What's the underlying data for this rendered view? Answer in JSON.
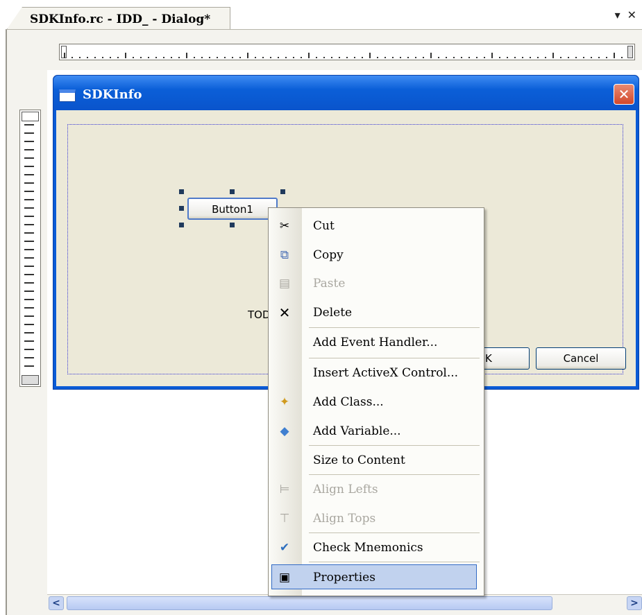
{
  "tab": {
    "title": "SDKInfo.rc - IDD_ - Dialog*",
    "pin_glyph": "▾",
    "close_glyph": "✕"
  },
  "dialog": {
    "title": "SDKInfo",
    "close_glyph": "✕",
    "button1_label": "Button1",
    "ok_label": "OK",
    "cancel_label": "Cancel",
    "static_text": "TODO"
  },
  "scrollbar": {
    "left_arrow": "<",
    "right_arrow": ">"
  },
  "context_menu": {
    "items": [
      {
        "label": "Cut",
        "icon": "scissors-icon",
        "glyph": "✂",
        "enabled": true
      },
      {
        "label": "Copy",
        "icon": "copy-icon",
        "glyph": "⧉",
        "enabled": true
      },
      {
        "label": "Paste",
        "icon": "paste-icon",
        "glyph": "▤",
        "enabled": false
      },
      {
        "label": "Delete",
        "icon": "delete-icon",
        "glyph": "✕",
        "enabled": true
      },
      {
        "label": "Add Event Handler...",
        "enabled": true
      },
      {
        "label": "Insert ActiveX Control...",
        "enabled": true
      },
      {
        "label": "Add Class...",
        "icon": "add-class-icon",
        "glyph": "✦",
        "enabled": true
      },
      {
        "label": "Add Variable...",
        "icon": "add-variable-icon",
        "glyph": "◆",
        "enabled": true
      },
      {
        "label": "Size to Content",
        "enabled": true
      },
      {
        "label": "Align Lefts",
        "icon": "align-lefts-icon",
        "glyph": "⊨",
        "enabled": false
      },
      {
        "label": "Align Tops",
        "icon": "align-tops-icon",
        "glyph": "⊤",
        "enabled": false
      },
      {
        "label": "Check Mnemonics",
        "icon": "check-mnemonics-icon",
        "glyph": "✔",
        "enabled": true
      },
      {
        "label": "Properties",
        "icon": "properties-icon",
        "glyph": "▣",
        "enabled": true,
        "highlighted": true
      }
    ]
  },
  "colors": {
    "titlebar_blue": "#0b5fd8",
    "dialog_face": "#ece9d8",
    "menu_highlight": "#c1d2ee",
    "disabled_text": "#a9a7a0",
    "close_red": "#d2482a"
  }
}
